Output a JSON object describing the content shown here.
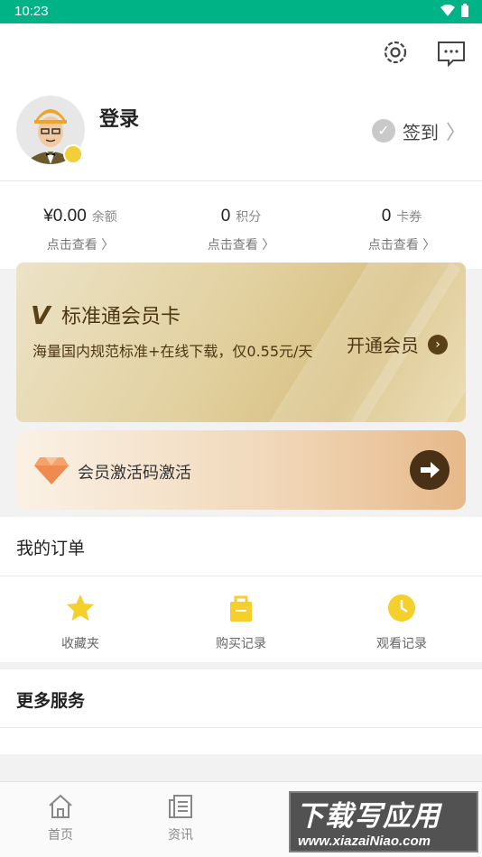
{
  "status_bar": {
    "time": "10:23"
  },
  "profile": {
    "login_label": "登录",
    "checkin_label": "签到"
  },
  "stats": [
    {
      "value": "¥0.00",
      "unit": "余额",
      "link": "点击查看 〉"
    },
    {
      "value": "0",
      "unit": "积分",
      "link": "点击查看 〉"
    },
    {
      "value": "0",
      "unit": "卡券",
      "link": "点击查看 〉"
    }
  ],
  "vip_card": {
    "badge": "V",
    "title": "标准通会员卡",
    "description": "海量国内规范标准+在线下载，仅0.55元/天",
    "open_label": "开通会员"
  },
  "activation": {
    "label": "会员激活码激活"
  },
  "orders": {
    "title": "我的订单",
    "shortcuts": [
      {
        "label": "收藏夹",
        "icon": "star-icon"
      },
      {
        "label": "购买记录",
        "icon": "bag-icon"
      },
      {
        "label": "观看记录",
        "icon": "clock-icon"
      }
    ]
  },
  "more_services": {
    "title": "更多服务"
  },
  "tabs": [
    {
      "label": "首页",
      "icon": "home-icon"
    },
    {
      "label": "资讯",
      "icon": "news-icon"
    }
  ],
  "watermark": {
    "line1": "下载写应用",
    "line2": "www.xiazaiNiao.com"
  },
  "colors": {
    "status_bar": "#00b386",
    "accent_gold": "#d7bf81",
    "icon_yellow": "#f5cf2b"
  }
}
